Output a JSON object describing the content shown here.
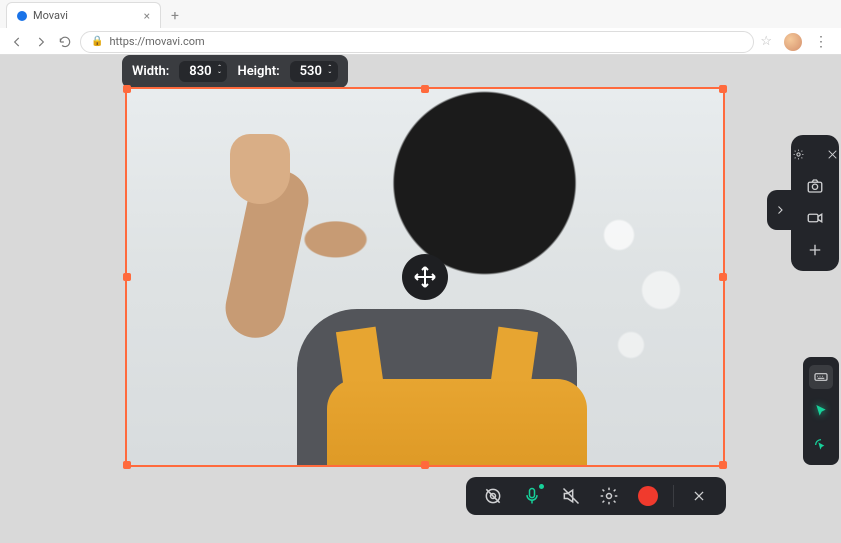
{
  "browser": {
    "tab_title": "Movavi",
    "url": "https://movavi.com"
  },
  "dimension_toolbar": {
    "width_label": "Width:",
    "width_value": "830",
    "height_label": "Height:",
    "height_value": "530"
  },
  "capture_region": {
    "move_handle": "move-handle"
  },
  "recorder_toolbar": {
    "webcam": "webcam-toggle",
    "mic": "microphone-toggle",
    "system_audio": "system-audio-toggle",
    "settings": "settings",
    "record": "record",
    "cancel": "cancel"
  },
  "side_panel": {
    "settings": "settings",
    "close": "close",
    "screenshot": "screenshot",
    "video": "record-video",
    "add": "add",
    "expand": "expand"
  },
  "effects_strip": {
    "keyboard": "show-keystrokes",
    "cursor_highlight": "highlight-cursor",
    "click_highlight": "highlight-clicks"
  },
  "colors": {
    "frame": "#ff6a3d",
    "accent_green": "#17d19a",
    "record_red": "#f03a2d",
    "panel": "#23252a"
  }
}
